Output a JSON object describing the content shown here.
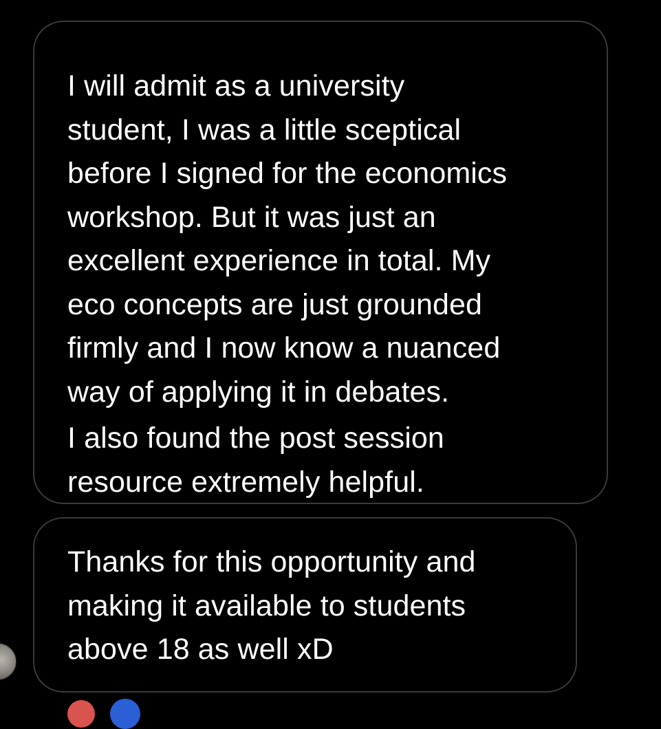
{
  "messages": [
    {
      "paragraphs": [
        [
          "I will admit as a university",
          "student, I was a little sceptical",
          "before I signed for the economics",
          "workshop. But it was just an",
          "excellent experience in total. My",
          "eco concepts are just grounded",
          "firmly and I now know a nuanced",
          "way of applying it in debates."
        ],
        [
          "I also found the post session",
          "resource extremely helpful."
        ]
      ]
    },
    {
      "paragraphs": [
        [
          "Thanks for this opportunity and",
          "making it available to students",
          "above 18 as well xD"
        ]
      ]
    }
  ],
  "sender_avatar_icon": "sender-avatar",
  "reaction_icons": [
    "heart-reaction-icon",
    "blue-reaction-icon"
  ],
  "colors": {
    "background": "#000000",
    "bubble_border": "#3a3a3c",
    "text": "#ffffff"
  }
}
